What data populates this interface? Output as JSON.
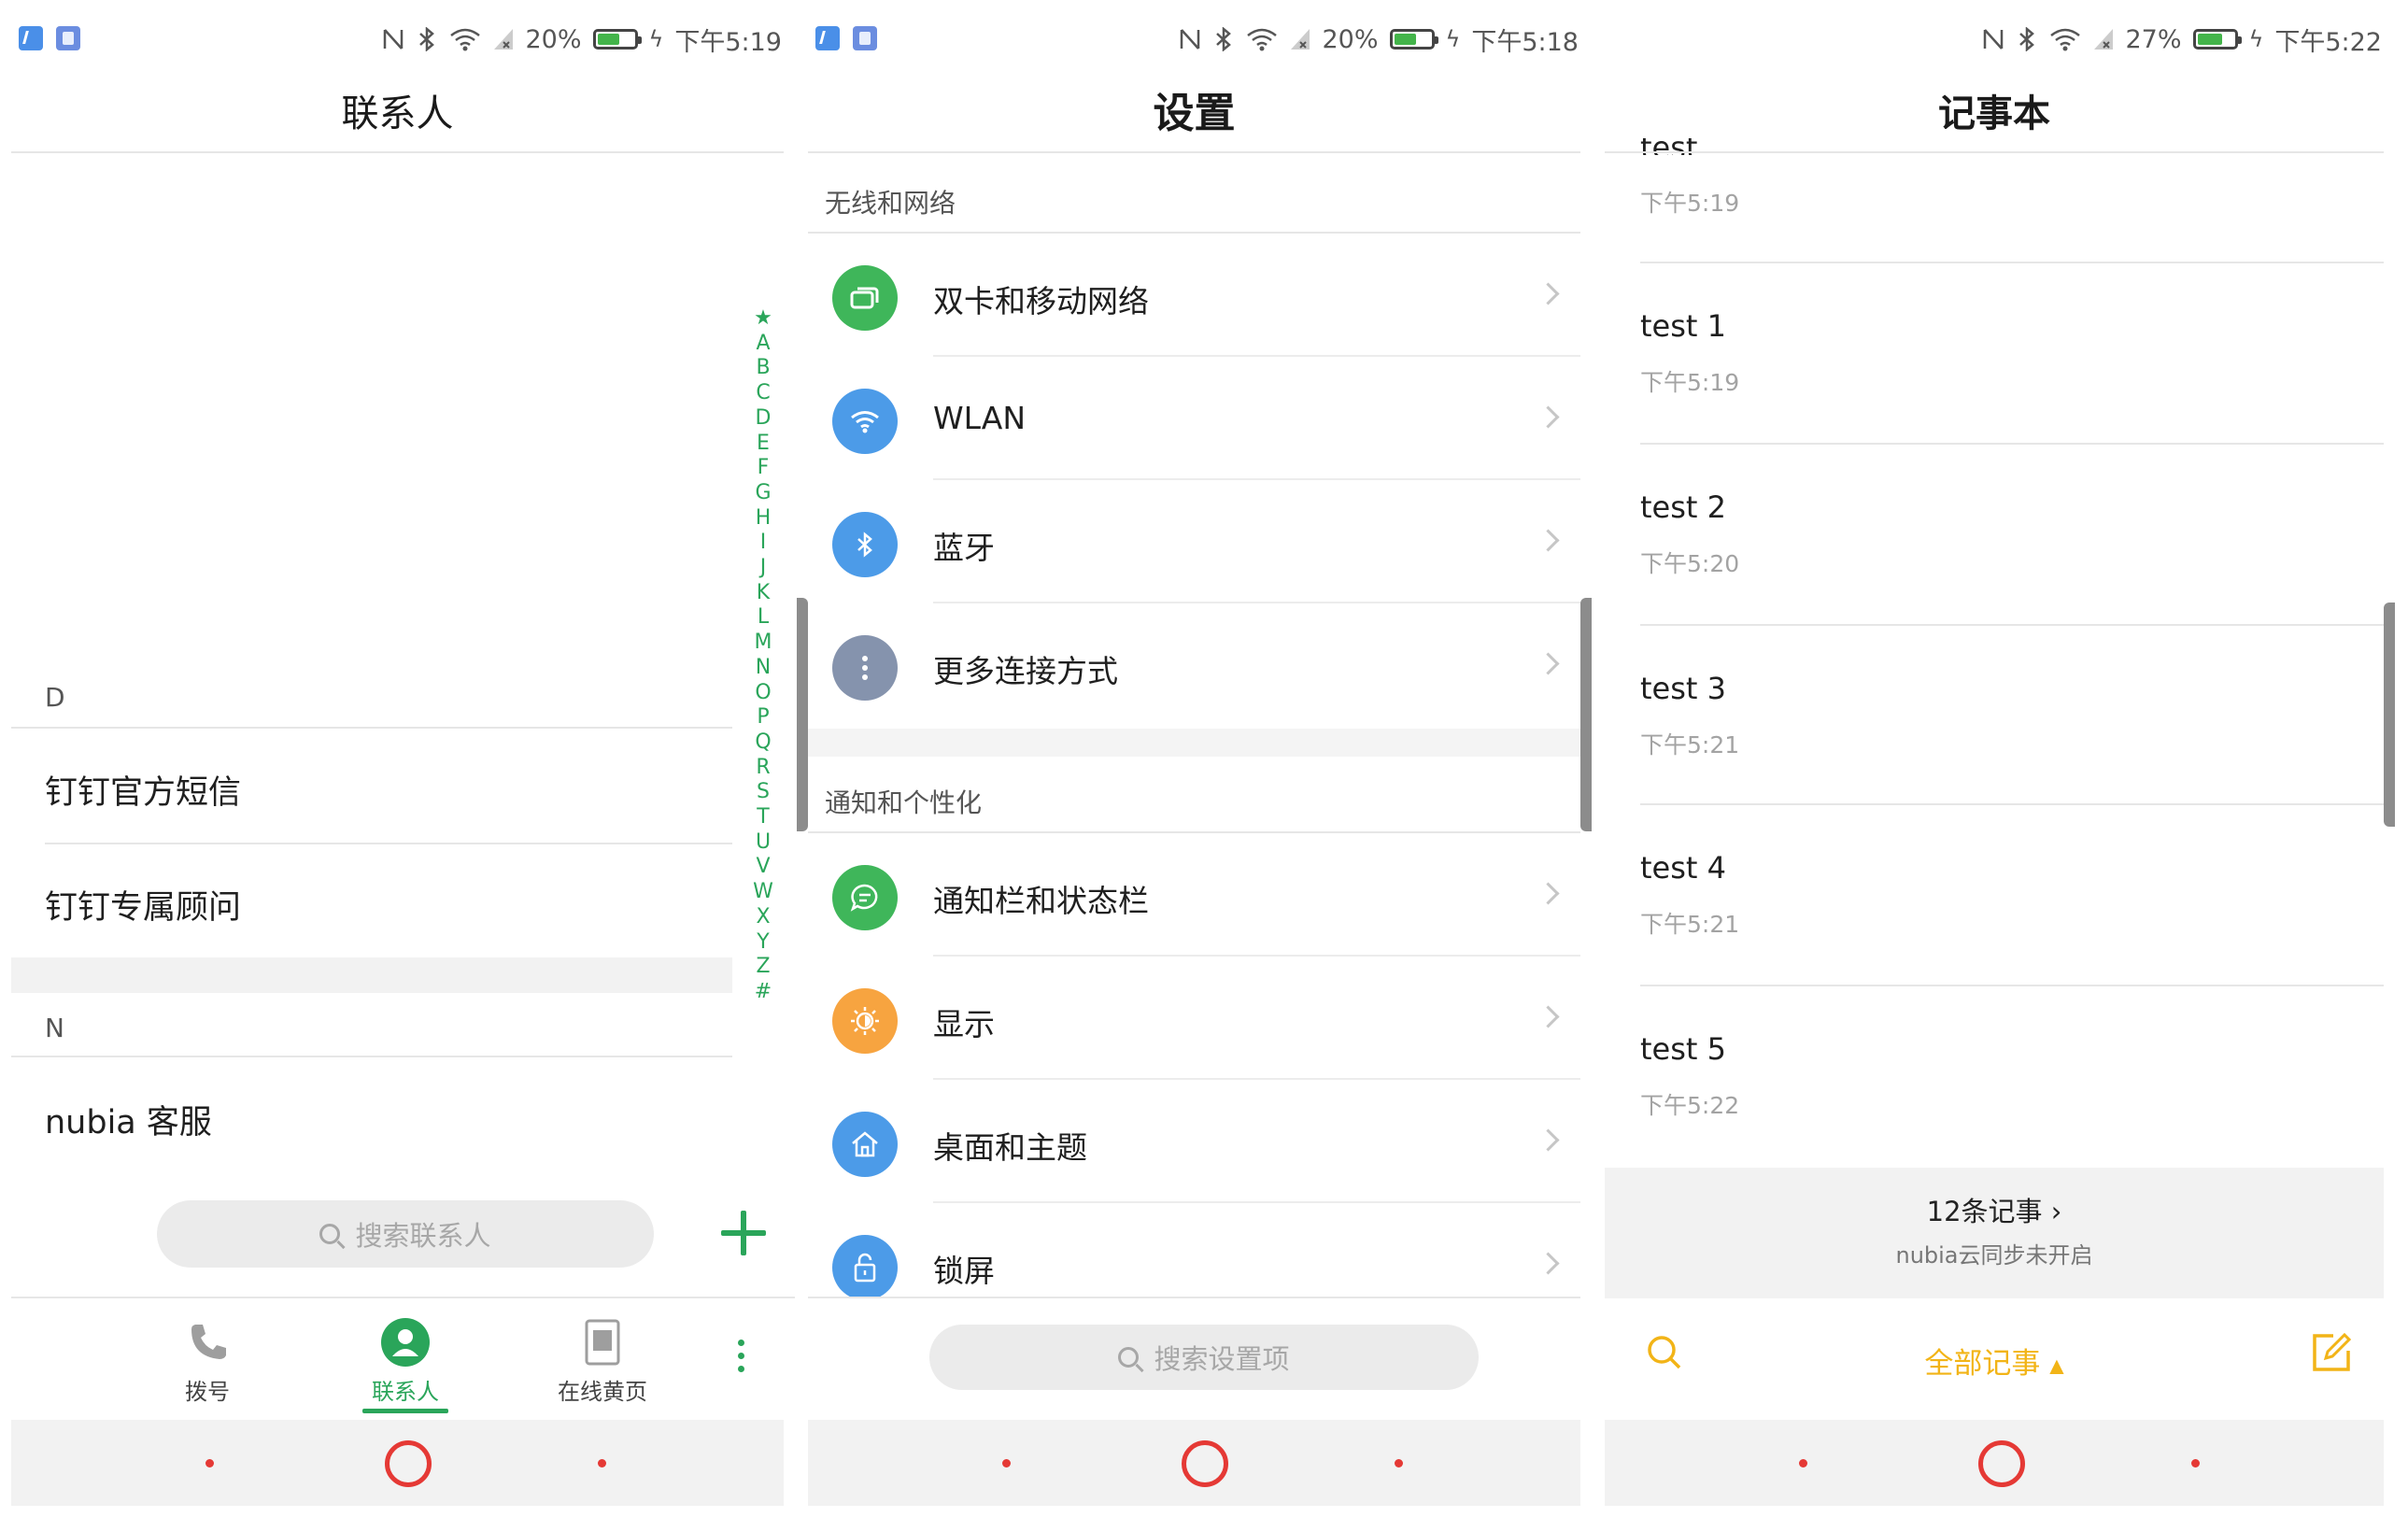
{
  "colors": {
    "accent_green": "#2aa55a",
    "accent_orange": "#f2b417",
    "nav_red": "#e53935"
  },
  "status_bars": [
    {
      "battery": "20%",
      "time": "下午5:19",
      "fill_pct": 0.6
    },
    {
      "battery": "20%",
      "time": "下午5:18",
      "fill_pct": 0.6
    },
    {
      "battery": "27%",
      "time": "下午5:22",
      "fill_pct": 0.7
    }
  ],
  "contacts": {
    "title": "联系人",
    "sections": [
      {
        "letter": "D",
        "items": [
          "钉钉官方短信",
          "钉钉专属顾问"
        ]
      },
      {
        "letter": "N",
        "items": [
          "nubia 客服"
        ]
      }
    ],
    "index": [
      "★",
      "A",
      "B",
      "C",
      "D",
      "E",
      "F",
      "G",
      "H",
      "I",
      "J",
      "K",
      "L",
      "M",
      "N",
      "O",
      "P",
      "Q",
      "R",
      "S",
      "T",
      "U",
      "V",
      "W",
      "X",
      "Y",
      "Z",
      "#"
    ],
    "search_placeholder": "搜索联系人",
    "tabs": [
      {
        "label": "拨号",
        "icon": "phone-icon"
      },
      {
        "label": "联系人",
        "icon": "contact-person-icon"
      },
      {
        "label": "在线黄页",
        "icon": "yellow-pages-icon"
      }
    ]
  },
  "settings": {
    "title": "设置",
    "sections": [
      {
        "header": "无线和网络",
        "items": [
          {
            "label": "双卡和移动网络",
            "icon": "dual-sim-icon",
            "color": "#3fb65a"
          },
          {
            "label": "WLAN",
            "icon": "wifi-icon",
            "color": "#4c9be8"
          },
          {
            "label": "蓝牙",
            "icon": "bluetooth-icon",
            "color": "#4c9be8"
          },
          {
            "label": "更多连接方式",
            "icon": "more-connections-icon",
            "color": "#8593ad"
          }
        ]
      },
      {
        "header": "通知和个性化",
        "items": [
          {
            "label": "通知栏和状态栏",
            "icon": "chat-bubble-icon",
            "color": "#3fb65a"
          },
          {
            "label": "显示",
            "icon": "brightness-icon",
            "color": "#f7a440"
          },
          {
            "label": "桌面和主题",
            "icon": "home-icon",
            "color": "#4c9be8"
          },
          {
            "label": "锁屏",
            "icon": "lock-icon",
            "color": "#4c9be8"
          }
        ]
      }
    ],
    "search_placeholder": "搜索设置项"
  },
  "notes": {
    "title": "记事本",
    "partial_title": "test",
    "items": [
      {
        "title": "",
        "time": "下午5:19"
      },
      {
        "title": "test 1",
        "time": "下午5:19"
      },
      {
        "title": "test 2",
        "time": "下午5:20"
      },
      {
        "title": "test 3",
        "time": "下午5:21"
      },
      {
        "title": "test 4",
        "time": "下午5:21"
      },
      {
        "title": "test 5",
        "time": "下午5:22"
      }
    ],
    "count_label": "12条记事",
    "sync_label": "nubia云同步未开启",
    "filter_label": "全部记事"
  }
}
